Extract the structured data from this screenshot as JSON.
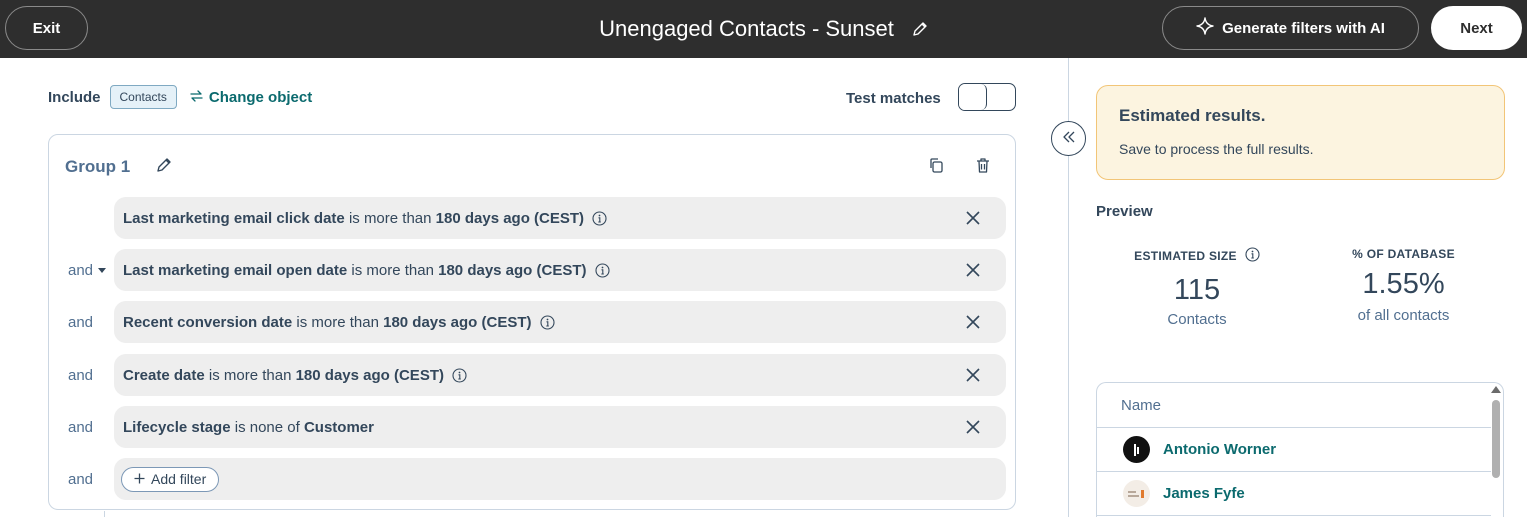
{
  "header": {
    "exit_label": "Exit",
    "title": "Unengaged Contacts - Sunset",
    "ai_label": "Generate filters with AI",
    "next_label": "Next"
  },
  "include": {
    "label": "Include",
    "object": "Contacts",
    "change_label": "Change object"
  },
  "test_matches": {
    "label": "Test matches",
    "enabled": false
  },
  "group": {
    "title": "Group 1",
    "filters": [
      {
        "connector": "",
        "property": "Last marketing email click date",
        "operator": "is more than",
        "value": "180 days ago (CEST)",
        "info": true
      },
      {
        "connector": "and",
        "property": "Last marketing email open date",
        "operator": "is more than",
        "value": "180 days ago (CEST)",
        "info": true,
        "dropdown": true
      },
      {
        "connector": "and",
        "property": "Recent conversion date",
        "operator": "is more than",
        "value": "180 days ago (CEST)",
        "info": true
      },
      {
        "connector": "and",
        "property": "Create date",
        "operator": "is more than",
        "value": "180 days ago (CEST)",
        "info": true
      },
      {
        "connector": "and",
        "property": "Lifecycle stage",
        "operator": "is none of",
        "value": "Customer",
        "info": false
      }
    ],
    "add_connector": "and",
    "add_filter_label": "Add filter"
  },
  "estimated": {
    "title": "Estimated results.",
    "subtitle": "Save to process the full results.",
    "accent": "#f2c577",
    "background": "#fcf4e0"
  },
  "preview": {
    "label": "Preview",
    "size_label": "ESTIMATED SIZE",
    "size_value": "115",
    "size_unit": "Contacts",
    "db_label": "% OF DATABASE",
    "db_value": "1.55%",
    "db_unit": "of all contacts",
    "table_header": "Name",
    "rows": [
      {
        "name": "Antonio Worner",
        "avatar": "dark-logo-avatar"
      },
      {
        "name": "James Fyfe",
        "avatar": "logo-avatar"
      }
    ]
  },
  "colors": {
    "topbar": "#2e2e2e",
    "link": "#0b6a6e",
    "text": "#33475b"
  }
}
